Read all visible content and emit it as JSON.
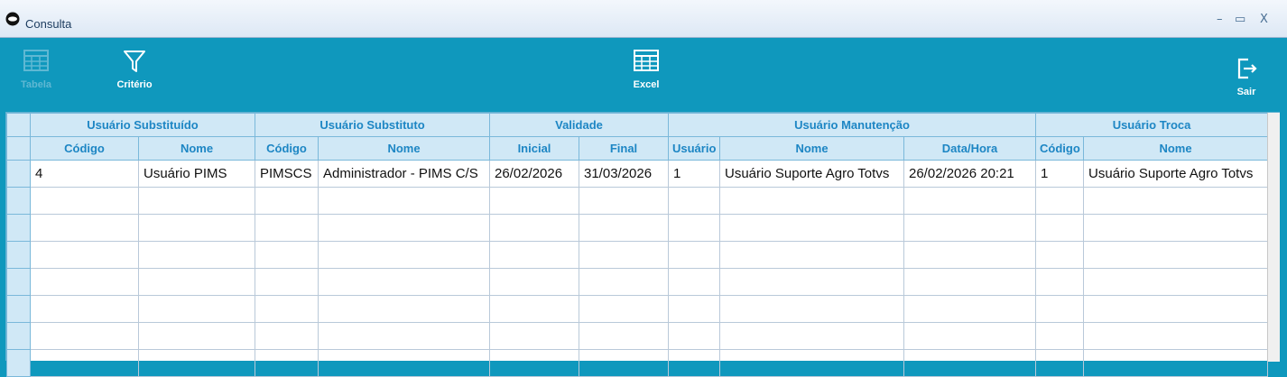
{
  "window": {
    "title": "Consulta",
    "minimize": "–",
    "maximize": "▭",
    "close": "X"
  },
  "toolbar": {
    "tabela": "Tabela",
    "criterio": "Critério",
    "excel": "Excel",
    "sair": "Sair"
  },
  "groups": [
    "Usuário Substituído",
    "Usuário Substituto",
    "Validade",
    "Usuário Manutenção",
    "Usuário Troca"
  ],
  "columns": [
    "Código",
    "Nome",
    "Código",
    "Nome",
    "Inicial",
    "Final",
    "Usuário",
    "Nome",
    "Data/Hora",
    "Código",
    "Nome"
  ],
  "rows": [
    [
      "4",
      "Usuário PIMS",
      "PIMSCS",
      "Administrador - PIMS C/S",
      "26/02/2026",
      "31/03/2026",
      "1",
      "Usuário Suporte Agro Totvs",
      "26/02/2026 20:21",
      "1",
      "Usuário Suporte Agro Totvs"
    ],
    [
      "",
      "",
      "",
      "",
      "",
      "",
      "",
      "",
      "",
      "",
      ""
    ],
    [
      "",
      "",
      "",
      "",
      "",
      "",
      "",
      "",
      "",
      "",
      ""
    ],
    [
      "",
      "",
      "",
      "",
      "",
      "",
      "",
      "",
      "",
      "",
      ""
    ],
    [
      "",
      "",
      "",
      "",
      "",
      "",
      "",
      "",
      "",
      "",
      ""
    ],
    [
      "",
      "",
      "",
      "",
      "",
      "",
      "",
      "",
      "",
      "",
      ""
    ],
    [
      "",
      "",
      "",
      "",
      "",
      "",
      "",
      "",
      "",
      "",
      ""
    ],
    [
      "",
      "",
      "",
      "",
      "",
      "",
      "",
      "",
      "",
      "",
      ""
    ]
  ]
}
